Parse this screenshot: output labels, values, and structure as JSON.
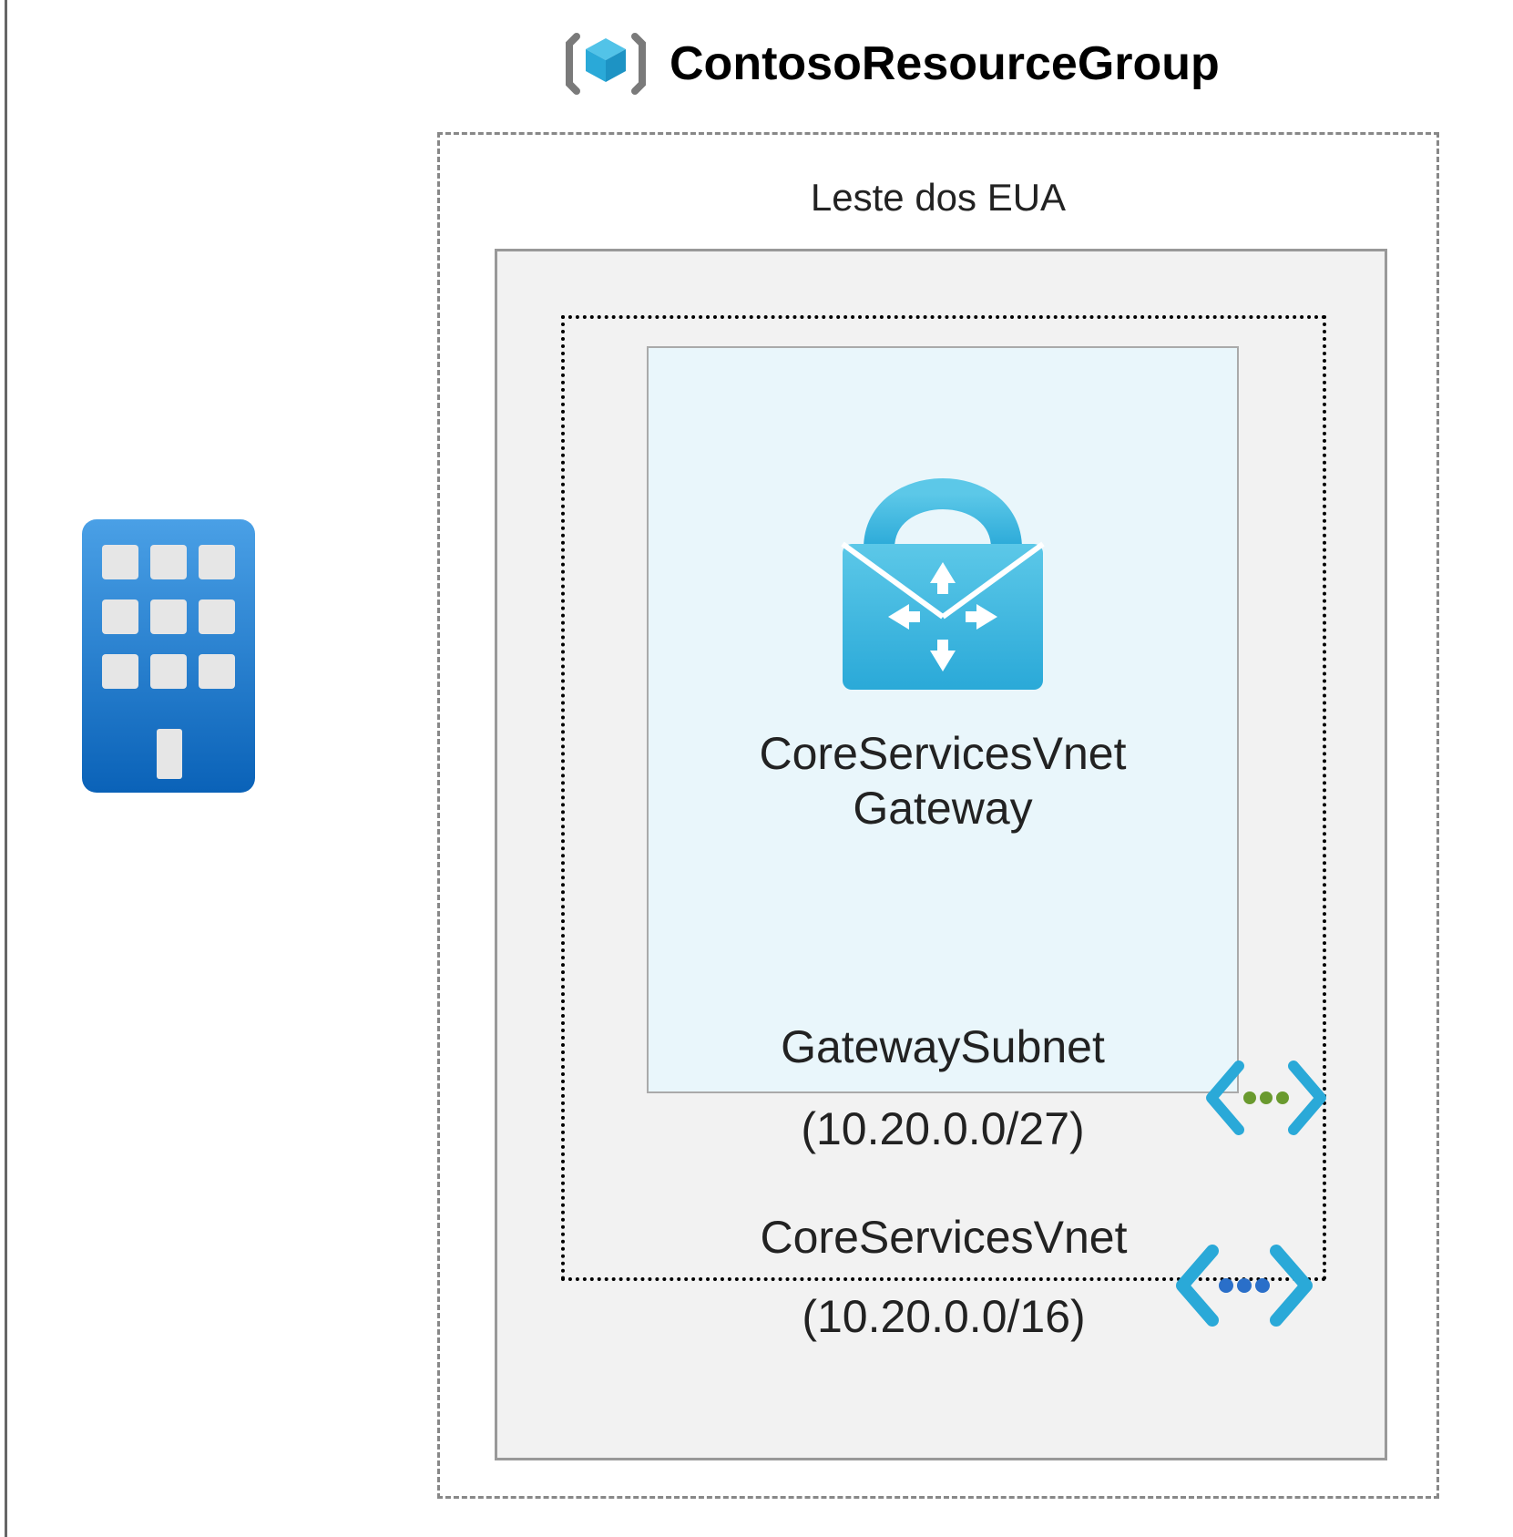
{
  "resource_group": {
    "title": "ContosoResourceGroup",
    "region_label": "Leste dos EUA"
  },
  "vnet": {
    "name": "CoreServicesVnet",
    "cidr": "(10.20.0.0/16)"
  },
  "subnet": {
    "name": "GatewaySubnet",
    "cidr": "(10.20.0.0/27)"
  },
  "gateway": {
    "label_line1": "CoreServicesVnet",
    "label_line2": "Gateway"
  }
}
